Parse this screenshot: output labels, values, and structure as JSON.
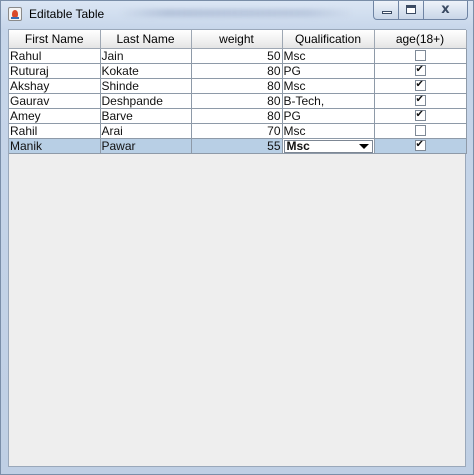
{
  "window": {
    "title": "Editable Table",
    "close_glyph": "x",
    "icon": "java-coffee-cup-icon"
  },
  "table": {
    "columns": [
      "First Name",
      "Last Name",
      "weight",
      "Qualification",
      "age(18+)"
    ],
    "rows": [
      {
        "first": "Rahul",
        "last": "Jain",
        "weight": "50",
        "qual": "Msc",
        "adult": false
      },
      {
        "first": "Ruturaj",
        "last": "Kokate",
        "weight": "80",
        "qual": "PG",
        "adult": true
      },
      {
        "first": "Akshay",
        "last": "Shinde",
        "weight": "80",
        "qual": "Msc",
        "adult": true
      },
      {
        "first": "Gaurav",
        "last": "Deshpande",
        "weight": "80",
        "qual": "B-Tech,",
        "adult": true
      },
      {
        "first": "Amey",
        "last": "Barve",
        "weight": "80",
        "qual": "PG",
        "adult": true
      },
      {
        "first": "Rahil",
        "last": "Arai",
        "weight": "70",
        "qual": "Msc",
        "adult": false
      },
      {
        "first": "Manik",
        "last": "Pawar",
        "weight": "55",
        "qual": "Msc",
        "adult": true
      }
    ],
    "selected_row": 6,
    "editing_column": "Qualification",
    "selection_color": "#b8cfe5"
  }
}
